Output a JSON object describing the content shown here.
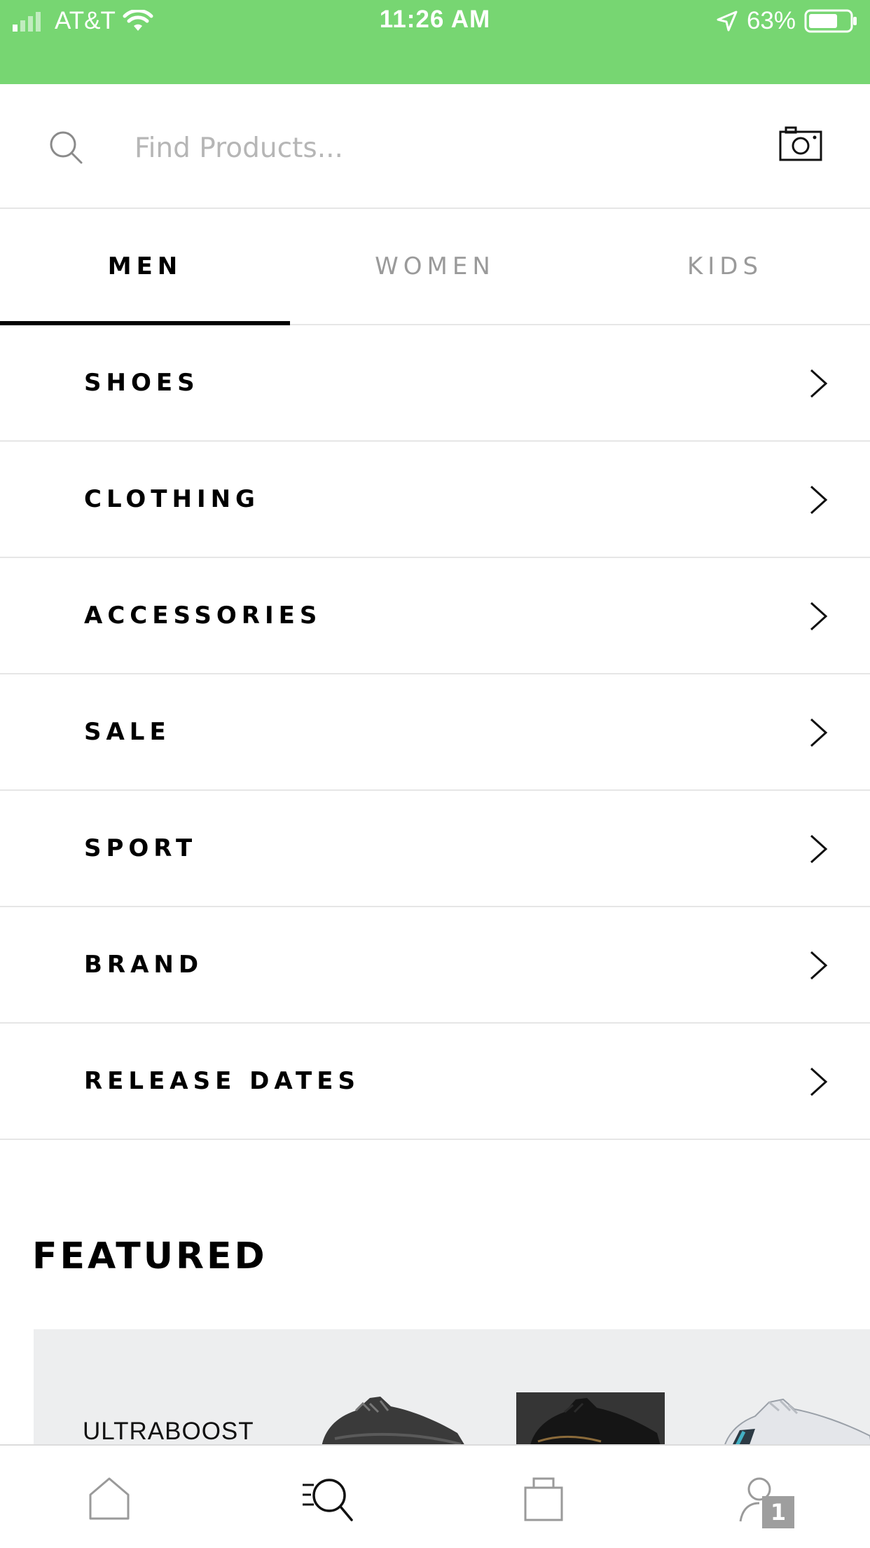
{
  "status_bar": {
    "carrier": "AT&T",
    "time": "11:26 AM",
    "battery": "63%"
  },
  "search": {
    "placeholder": "Find Products..."
  },
  "tabs": [
    {
      "label": "MEN",
      "active": true
    },
    {
      "label": "WOMEN",
      "active": false
    },
    {
      "label": "KIDS",
      "active": false
    }
  ],
  "categories": [
    {
      "label": "SHOES"
    },
    {
      "label": "CLOTHING"
    },
    {
      "label": "ACCESSORIES"
    },
    {
      "label": "SALE"
    },
    {
      "label": "SPORT"
    },
    {
      "label": "BRAND"
    },
    {
      "label": "RELEASE DATES"
    }
  ],
  "featured": {
    "title": "FEATURED",
    "card_label": "ULTRABOOST"
  },
  "bottom_nav": {
    "items": [
      "home-icon",
      "search-icon",
      "bag-icon",
      "profile-icon"
    ],
    "active": "search-icon",
    "profile_badge": "1"
  },
  "colors": {
    "status_bar": "#77d672",
    "divider": "#e6e6e6",
    "inactive_tab": "#9a9a9a",
    "card_bg": "#edeeef",
    "badge": "#9e9e9e"
  }
}
